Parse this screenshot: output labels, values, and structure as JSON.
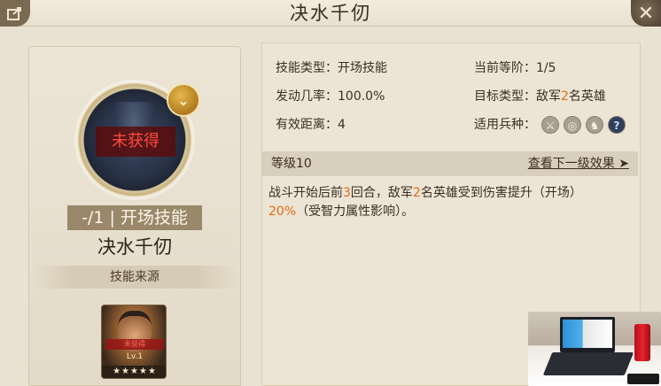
{
  "header": {
    "title": "决水千仞"
  },
  "left": {
    "status": "未获得",
    "type_label": "-/1 | 开场技能",
    "skill_name": "决水千仞",
    "source_label": "技能来源",
    "hero": {
      "tag": "未获得",
      "level": "Lv.1",
      "stars": "★★★★★"
    }
  },
  "info": {
    "skill_type": "技能类型：开场技能",
    "current_rank": "当前等阶：1/5",
    "trigger_rate": "发动几率：100.0%",
    "target_type_prefix": "目标类型：敌军",
    "target_type_num": "2",
    "target_type_suffix": "名英雄",
    "range": "有效距离：4",
    "troop_label": "适用兵种："
  },
  "level": {
    "label": "等级10",
    "next": "查看下一级效果 ➤"
  },
  "desc": {
    "p1": "战斗开始后前",
    "n1": "3",
    "p2": "回合，敌军",
    "n2": "2",
    "p3": "名英雄受到伤害提升（开场）",
    "n3": "20%",
    "p4": "（受智力属性影响）。"
  },
  "troops": [
    "sword-troop-icon",
    "shield-troop-icon",
    "cavalry-troop-icon",
    "question-icon"
  ],
  "colors": {
    "highlight": "#e46a16",
    "unobtained": "#ff4b3d",
    "background": "#e9e2d3"
  }
}
